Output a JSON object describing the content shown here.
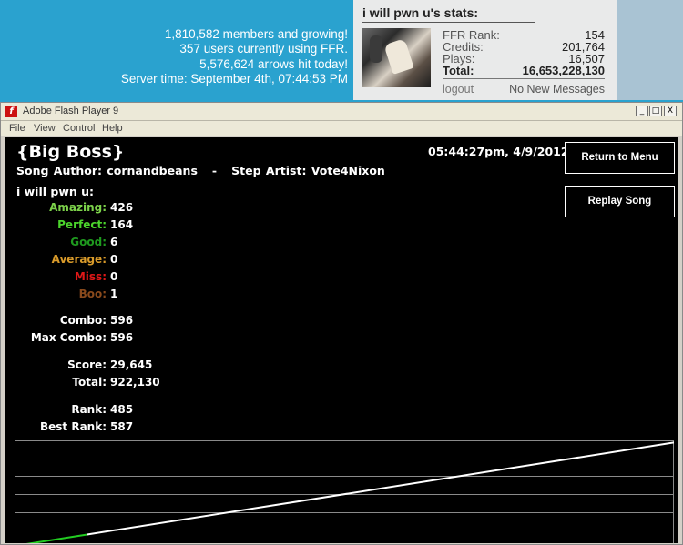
{
  "site": {
    "stats_lines": [
      "1,810,582 members and growing!",
      "357 users currently using FFR.",
      "5,576,624 arrows hit today!",
      "Server time: September 4th, 07:44:53 PM"
    ]
  },
  "user_panel": {
    "title": "i will pwn u's stats:",
    "rows": [
      {
        "label": "FFR Rank:",
        "value": "154"
      },
      {
        "label": "Credits:",
        "value": "201,764"
      },
      {
        "label": "Plays:",
        "value": "16,507"
      },
      {
        "label": "Total:",
        "value": "16,653,228,130"
      }
    ],
    "logout": "logout",
    "messages": "No New Messages"
  },
  "window": {
    "title": "Adobe Flash Player 9",
    "menu": [
      "File",
      "View",
      "Control",
      "Help"
    ],
    "buttons": {
      "minimize": "_",
      "maximize": "□",
      "close": "X"
    }
  },
  "game": {
    "song_title": "{Big Boss}",
    "song_credits": "Song Author: cornandbeans   -   Step Artist: Vote4Nixon",
    "timestamp": "05:44:27pm, 4/9/2012",
    "player": "i will pwn u:",
    "judgements": [
      {
        "label": "Amazing:",
        "value": "426",
        "color": "#7cd14a"
      },
      {
        "label": "Perfect:",
        "value": "164",
        "color": "#4bd42c"
      },
      {
        "label": "Good:",
        "value": "6",
        "color": "#1f9a1f"
      },
      {
        "label": "Average:",
        "value": "0",
        "color": "#d89a2a"
      },
      {
        "label": "Miss:",
        "value": "0",
        "color": "#e01818"
      },
      {
        "label": "Boo:",
        "value": "1",
        "color": "#8a4a1c"
      }
    ],
    "combo": [
      {
        "label": "Combo:",
        "value": "596"
      },
      {
        "label": "Max Combo:",
        "value": "596"
      }
    ],
    "score": [
      {
        "label": "Score:",
        "value": "29,645"
      },
      {
        "label": "Total:",
        "value": "922,130"
      }
    ],
    "rank": [
      {
        "label": "Rank:",
        "value": "485"
      },
      {
        "label": "Best Rank:",
        "value": "587"
      }
    ],
    "return_button": "Return to Menu",
    "replay_button": "Replay Song",
    "graph": {
      "green_end_fraction": 0.11,
      "end_level": 0.98,
      "colors": {
        "early": "#22cc22",
        "late": "#ffffff",
        "grid": "#8a8a8a"
      }
    }
  }
}
